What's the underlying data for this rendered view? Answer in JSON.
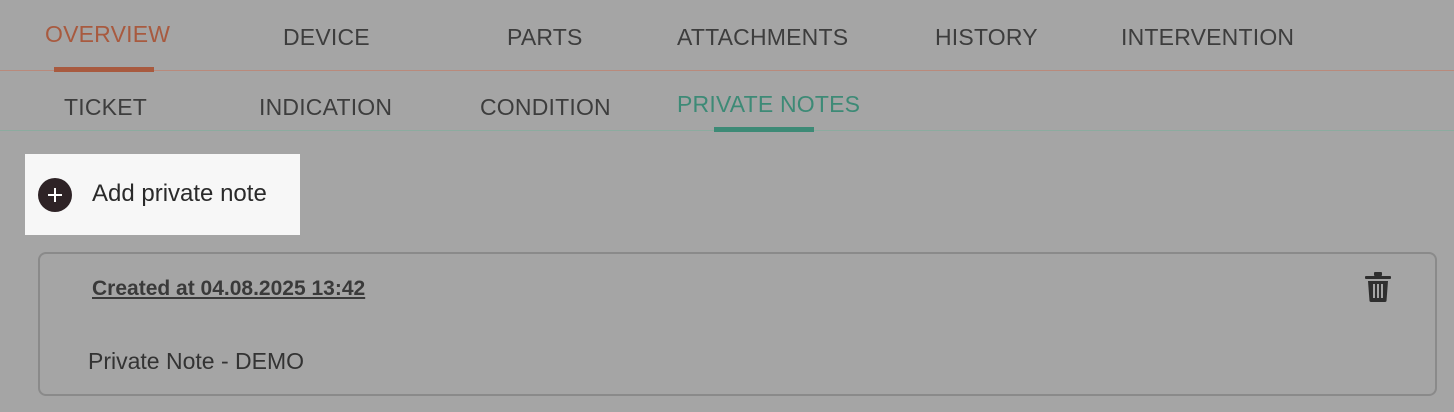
{
  "primary_tabs": [
    {
      "label": "OVERVIEW",
      "active": true
    },
    {
      "label": "DEVICE",
      "active": false
    },
    {
      "label": "PARTS",
      "active": false
    },
    {
      "label": "ATTACHMENTS",
      "active": false
    },
    {
      "label": "HISTORY",
      "active": false
    },
    {
      "label": "INTERVENTION",
      "active": false
    }
  ],
  "secondary_tabs": [
    {
      "label": "TICKET",
      "active": false
    },
    {
      "label": "INDICATION",
      "active": false
    },
    {
      "label": "CONDITION",
      "active": false
    },
    {
      "label": "PRIVATE NOTES",
      "active": true
    }
  ],
  "add_note": {
    "label": "Add private note",
    "icon": "plus-circle-icon"
  },
  "notes": [
    {
      "created": "Created at 04.08.2025 13:42",
      "text": "Private Note - DEMO",
      "delete_icon": "trash-icon"
    }
  ],
  "colors": {
    "primary_accent": "#a85a3f",
    "secondary_accent": "#3d8a76",
    "background": "#a5a5a5"
  }
}
